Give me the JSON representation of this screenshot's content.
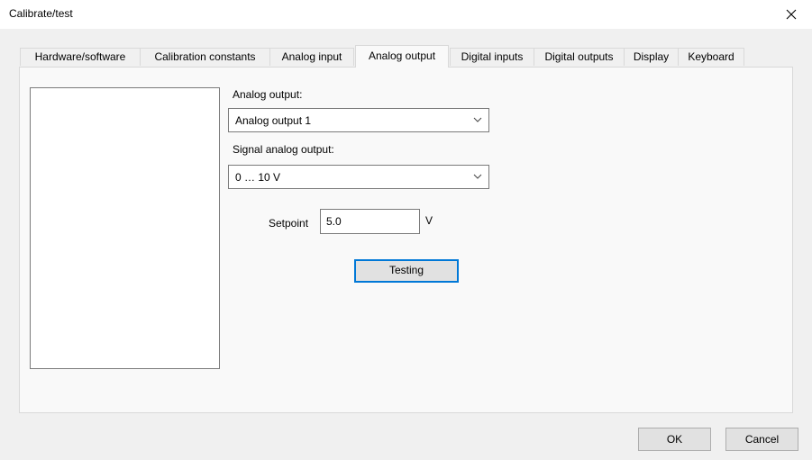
{
  "window": {
    "title": "Calibrate/test"
  },
  "tabs": [
    {
      "label": "Hardware/software"
    },
    {
      "label": "Calibration constants"
    },
    {
      "label": "Analog input"
    },
    {
      "label": "Analog output",
      "active": true
    },
    {
      "label": "Digital inputs"
    },
    {
      "label": "Digital outputs"
    },
    {
      "label": "Display"
    },
    {
      "label": "Keyboard"
    }
  ],
  "panel": {
    "analog_output_label": "Analog output:",
    "analog_output_value": "Analog output 1",
    "signal_label": "Signal analog output:",
    "signal_value": "0 … 10 V",
    "setpoint_label": "Setpoint",
    "setpoint_value": "5.0",
    "setpoint_unit": "V",
    "testing_label": "Testing"
  },
  "footer": {
    "ok_label": "OK",
    "cancel_label": "Cancel"
  },
  "icons": {
    "close": "close-icon",
    "dropdown": "chevron-down-icon"
  },
  "colors": {
    "accent": "#0078d7",
    "background": "#f0f0f0",
    "panel": "#f9f9f9"
  }
}
